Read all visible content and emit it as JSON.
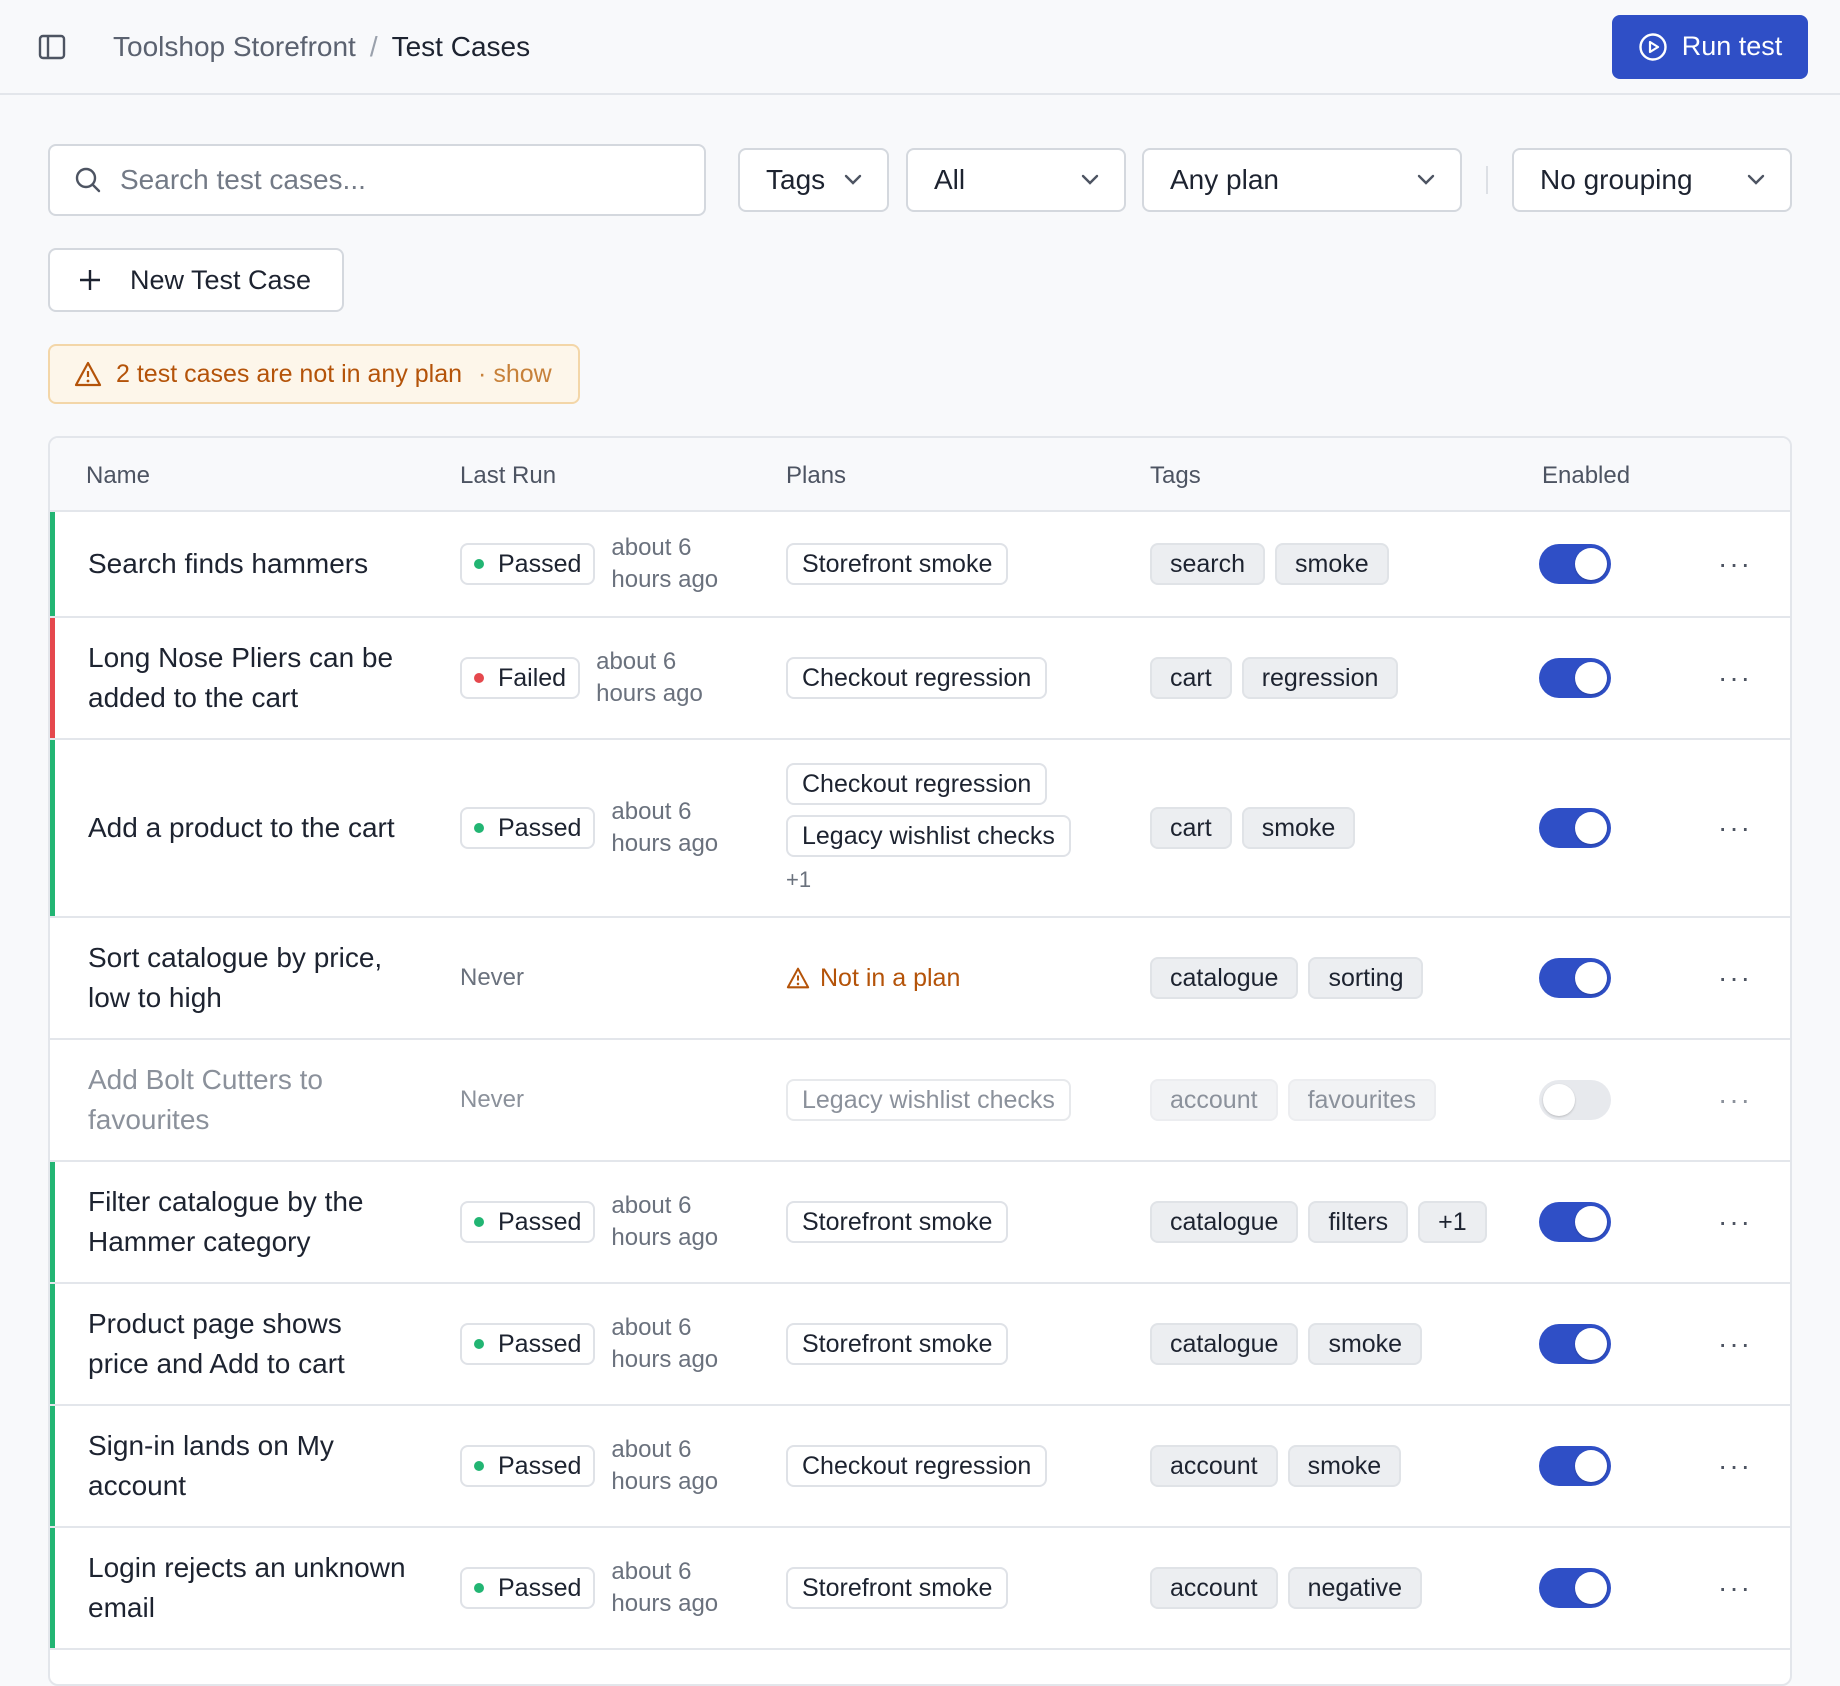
{
  "header": {
    "breadcrumb_project": "Toolshop Storefront",
    "breadcrumb_separator": "/",
    "breadcrumb_current": "Test Cases",
    "run_button_label": "Run test"
  },
  "toolbar": {
    "search_placeholder": "Search test cases...",
    "tags_filter": "Tags",
    "status_filter": "All",
    "plan_filter": "Any plan",
    "grouping_filter": "No grouping",
    "new_button_label": "New Test Case"
  },
  "warning": {
    "text": "2 test cases are not in any plan",
    "action": "· show"
  },
  "table": {
    "headers": {
      "name": "Name",
      "last_run": "Last Run",
      "plans": "Plans",
      "tags": "Tags",
      "enabled": "Enabled"
    },
    "rows": [
      {
        "name": "Search finds hammers",
        "status": "Passed",
        "last_run_ago": "about 6 hours ago",
        "plans": [
          "Storefront smoke"
        ],
        "plans_more": "",
        "tags": [
          "search",
          "smoke"
        ],
        "enabled": true
      },
      {
        "name": "Long Nose Pliers can be added to the cart",
        "status": "Failed",
        "last_run_ago": "about 6 hours ago",
        "plans": [
          "Checkout regression"
        ],
        "plans_more": "",
        "tags": [
          "cart",
          "regression"
        ],
        "enabled": true
      },
      {
        "name": "Add a product to the cart",
        "status": "Passed",
        "last_run_ago": "about 6 hours ago",
        "plans": [
          "Checkout regression",
          "Legacy wishlist checks"
        ],
        "plans_more": "+1",
        "tags": [
          "cart",
          "smoke"
        ],
        "enabled": true
      },
      {
        "name": "Sort catalogue by price, low to high",
        "status": "",
        "last_run_ago": "Never",
        "plans": [],
        "not_in_plan": "Not in a plan",
        "plans_more": "",
        "tags": [
          "catalogue",
          "sorting"
        ],
        "enabled": true
      },
      {
        "name": "Add Bolt Cutters to favourites",
        "status": "",
        "last_run_ago": "Never",
        "plans": [
          "Legacy wishlist checks"
        ],
        "plans_more": "",
        "tags": [
          "account",
          "favourites"
        ],
        "enabled": false
      },
      {
        "name": "Filter catalogue by the Hammer category",
        "status": "Passed",
        "last_run_ago": "about 6 hours ago",
        "plans": [
          "Storefront smoke"
        ],
        "plans_more": "",
        "tags": [
          "catalogue",
          "filters",
          "+1"
        ],
        "enabled": true
      },
      {
        "name": "Product page shows price and Add to cart",
        "status": "Passed",
        "last_run_ago": "about 6 hours ago",
        "plans": [
          "Storefront smoke"
        ],
        "plans_more": "",
        "tags": [
          "catalogue",
          "smoke"
        ],
        "enabled": true
      },
      {
        "name": "Sign-in lands on My account",
        "status": "Passed",
        "last_run_ago": "about 6 hours ago",
        "plans": [
          "Checkout regression"
        ],
        "plans_more": "",
        "tags": [
          "account",
          "smoke"
        ],
        "enabled": true
      },
      {
        "name": "Login rejects an unknown email",
        "status": "Passed",
        "last_run_ago": "about 6 hours ago",
        "plans": [
          "Storefront smoke"
        ],
        "plans_more": "",
        "tags": [
          "account",
          "negative"
        ],
        "enabled": true
      }
    ],
    "more_label": "···"
  },
  "colors": {
    "primary": "#2f4fc6",
    "passed": "#22b573",
    "failed": "#e5484d",
    "warning": "#b45309"
  }
}
